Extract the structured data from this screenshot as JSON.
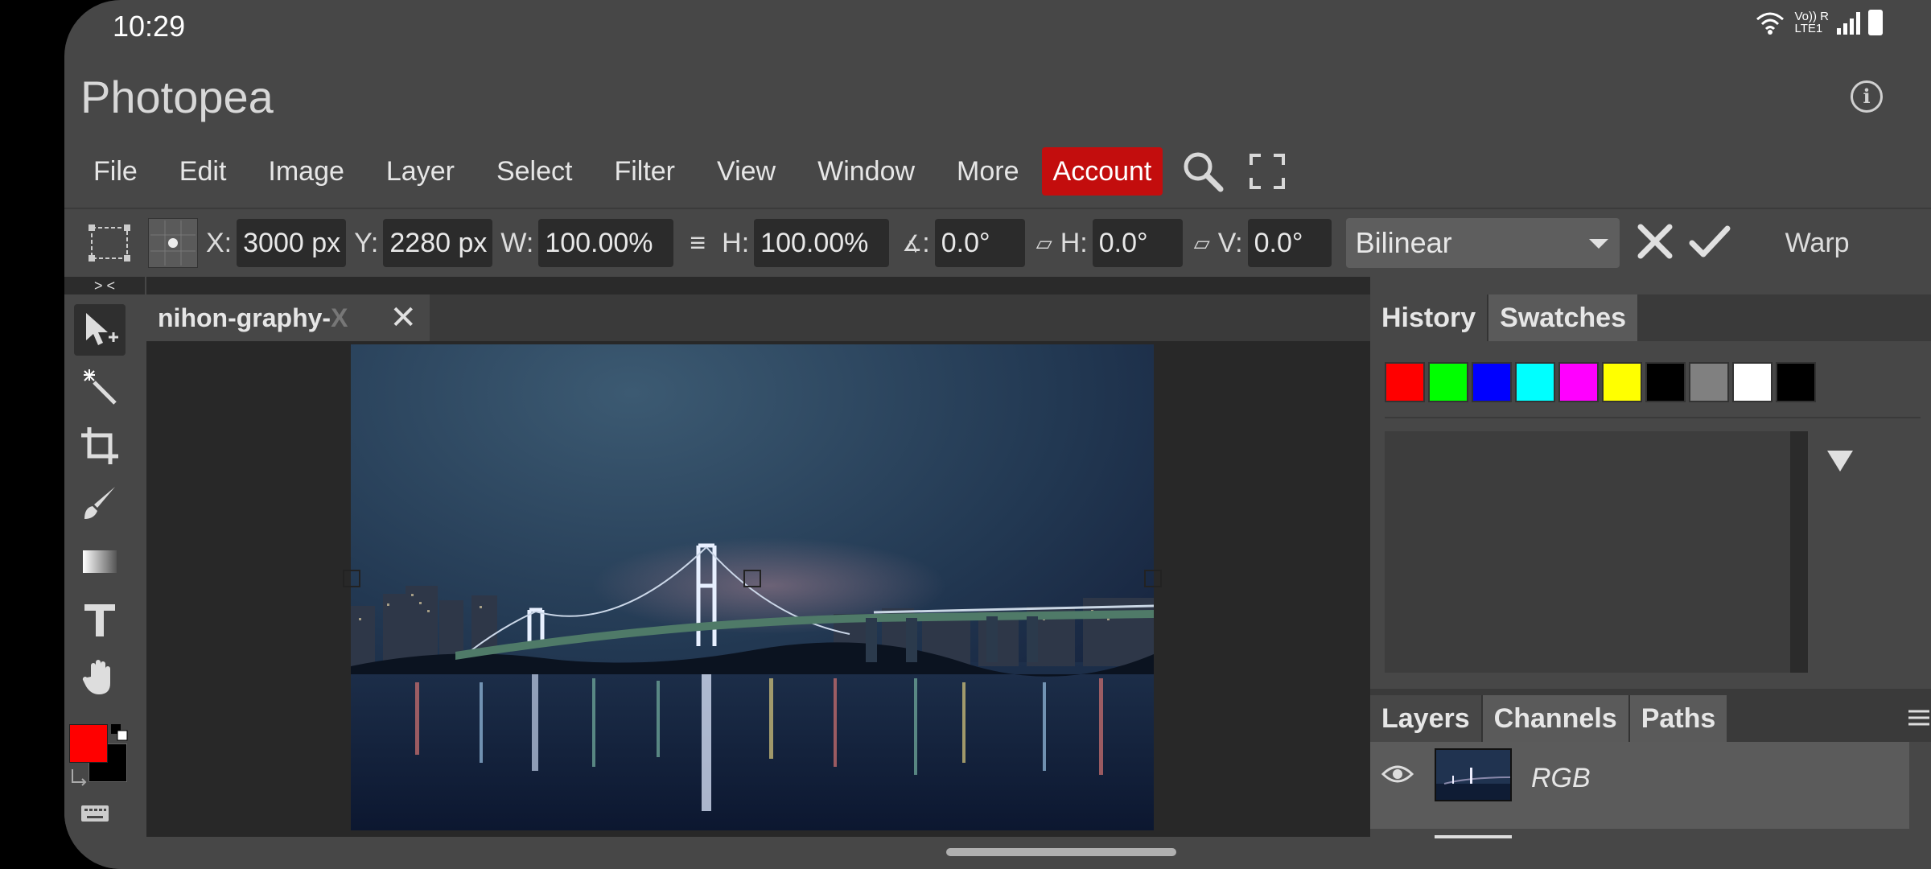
{
  "status_bar": {
    "time": "10:29",
    "carrier_text": "Vo)) R\nLTE1"
  },
  "app": {
    "title": "Photopea"
  },
  "menu": {
    "items": [
      "File",
      "Edit",
      "Image",
      "Layer",
      "Select",
      "Filter",
      "View",
      "Window",
      "More"
    ],
    "account": "Account"
  },
  "options": {
    "x_label": "X:",
    "x_value": "3000 px",
    "y_label": "Y:",
    "y_value": "2280 px",
    "w_label": "W:",
    "w_value": "100.00%",
    "h_label": "H:",
    "h_value": "100.00%",
    "angle_label": ":",
    "angle_value": "0.0°",
    "skew_h_label": "H:",
    "skew_h_value": "0.0°",
    "skew_v_label": "V:",
    "skew_v_value": "0.0°",
    "interpolation": "Bilinear",
    "warp": "Warp"
  },
  "collapse": {
    "left": "> <",
    "right": "> <"
  },
  "document": {
    "tab_title": "nihon-graphy-",
    "tab_title_faded": "X"
  },
  "history_panel": {
    "tabs": [
      "History",
      "Swatches"
    ],
    "active": "Swatches"
  },
  "swatches": [
    "#ff0000",
    "#00ff00",
    "#0000ff",
    "#00ffff",
    "#ff00ff",
    "#ffff00",
    "#000000",
    "#808080",
    "#ffffff",
    "#000000"
  ],
  "layers_panel": {
    "tabs": [
      "Layers",
      "Channels",
      "Paths"
    ],
    "active": "Channels",
    "rows": [
      {
        "name": "RGB"
      }
    ]
  },
  "colors": {
    "foreground": "#ff0000",
    "background": "#000000",
    "accent": "#c30d0d"
  }
}
